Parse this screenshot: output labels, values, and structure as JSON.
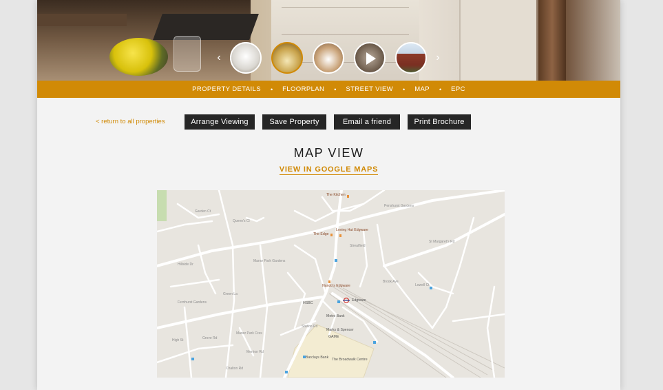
{
  "hero": {
    "prev_arrow": "‹",
    "next_arrow": "›",
    "thumbnails": [
      "living-room",
      "kitchen",
      "dining-room",
      "video",
      "exterior"
    ]
  },
  "nav": {
    "items": [
      "PROPERTY DETAILS",
      "FLOORPLAN",
      "STREET VIEW",
      "MAP",
      "EPC"
    ],
    "separator": "•"
  },
  "actions": {
    "back_link": "< return to all properties",
    "arrange_viewing": "Arrange Viewing",
    "save_property": "Save Property",
    "email_friend": "Email a friend",
    "print_brochure": "Print Brochure"
  },
  "map_section": {
    "title": "MAP VIEW",
    "google_link": "VIEW IN GOOGLE MAPS"
  },
  "map": {
    "pois": {
      "kitchen": "The Kitchen",
      "loving_hut": "Loving Hut Edgware",
      "edge": "The Edge",
      "nandos": "Nando's Edgware",
      "hsbc": "HSBC",
      "edgware": "Edgware",
      "metro_bank": "Metro Bank",
      "marks": "Marks & Spencer",
      "game": "GAME",
      "barclays": "Barclays Bank",
      "broadwalk": "The Broadwalk Centre"
    },
    "streets": {
      "penshurst": "Penshurst Gardens",
      "st_margarets": "St Margaret's Rd",
      "queens_cl": "Queen's Cl",
      "garden_ct": "Garden Ct",
      "manor_park": "Manor Park Gardens",
      "fernhurst": "Fernhurst Gardens",
      "hillside": "Hillside Dr",
      "green_la": "Green La",
      "manor_park_cres": "Manor Park Cres",
      "station_rd": "Station Rd",
      "merrion": "Merrion Rd",
      "brook_ave": "Brook Ave",
      "lowell": "Lowell Ct",
      "high_st": "High St",
      "grove_rd": "Grove Rd",
      "cavendish": "Chalton Rd",
      "strawen": "Streatfield"
    },
    "colors": {
      "land": "#e8e5df",
      "road": "#ffffff",
      "rail": "#c9c4bd",
      "park": "#c7ddb0",
      "mall": "#f3ecd2"
    }
  }
}
